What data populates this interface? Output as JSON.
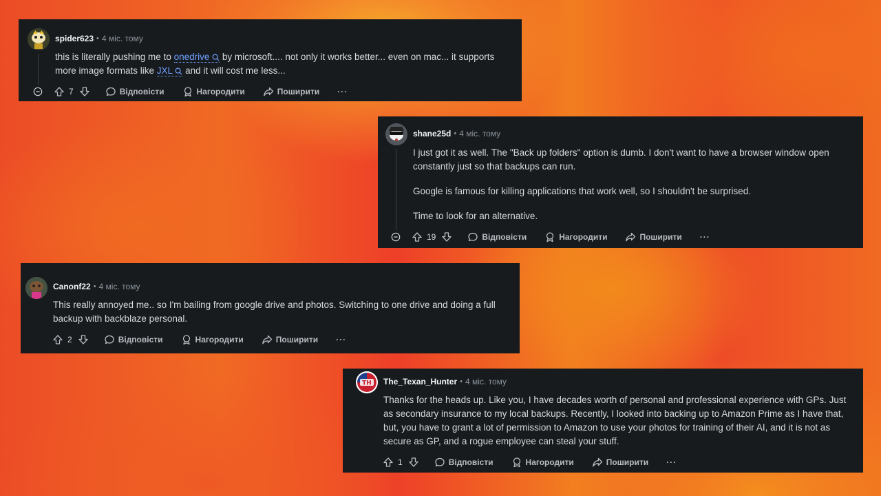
{
  "comments": [
    {
      "username": "spider623",
      "time": "4 міс. тому",
      "body_parts": {
        "t1": "this is literally pushing me to ",
        "link1": "onedrive",
        "t2": " by microsoft.... not only it works better... even on mac... it supports more image formats like ",
        "link2": "JXL",
        "t3": " and it will cost me less..."
      },
      "votes": "7",
      "reply_label": "Відповісти",
      "award_label": "Нагородити",
      "share_label": "Поширити",
      "more_label": "···"
    },
    {
      "username": "shane25d",
      "time": "4 міс. тому",
      "paragraphs": [
        "I just got it as well. The \"Back up folders\" option is dumb. I don't want to have a browser window open constantly just so that backups can run.",
        "Google is famous for killing applications that work well, so I shouldn't be surprised.",
        "Time to look for an alternative."
      ],
      "votes": "19",
      "reply_label": "Відповісти",
      "award_label": "Нагородити",
      "share_label": "Поширити",
      "more_label": "···"
    },
    {
      "username": "Canonf22",
      "time": "4 міс. тому",
      "paragraphs": [
        "This really annoyed me.. so I'm bailing from google drive and photos. Switching to one drive and doing a full backup with backblaze personal."
      ],
      "votes": "2",
      "reply_label": "Відповісти",
      "award_label": "Нагородити",
      "share_label": "Поширити",
      "more_label": "···"
    },
    {
      "username": "The_Texan_Hunter",
      "time": "4 міс. тому",
      "paragraphs": [
        "Thanks for the heads up. Like you, I have decades worth of personal and professional experience with GPs. Just as secondary insurance to my local backups. Recently, I looked into backing up to Amazon Prime as I have that, but, you have to grant a lot of permission to Amazon to use your photos for training of their AI, and it is not as secure as GP, and a rogue employee can steal your stuff."
      ],
      "avatar_text": "TH",
      "votes": "1",
      "reply_label": "Відповісти",
      "award_label": "Нагородити",
      "share_label": "Поширити",
      "more_label": "···"
    }
  ],
  "colors": {
    "card_bg": "#181b1e",
    "link": "#6ea0ff",
    "meta": "#8b959c"
  },
  "icons": [
    "collapse-icon",
    "upvote-icon",
    "downvote-icon",
    "reply-icon",
    "award-icon",
    "share-icon",
    "search-icon"
  ]
}
